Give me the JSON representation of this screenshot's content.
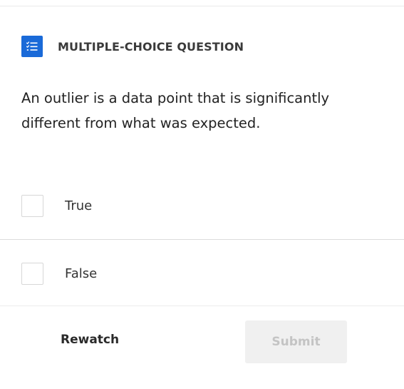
{
  "header": {
    "icon": "checklist-icon",
    "question_type": "MULTIPLE-CHOICE QUESTION"
  },
  "question": {
    "text": "An outlier is a data point that is significantly different from what was expected."
  },
  "options": [
    {
      "label": "True",
      "checked": false
    },
    {
      "label": "False",
      "checked": false
    }
  ],
  "footer": {
    "rewatch_label": "Rewatch",
    "submit_label": "Submit",
    "submit_enabled": false
  },
  "colors": {
    "accent": "#1a6ad8",
    "submit_bg_disabled": "#f0f0f0",
    "submit_text_disabled": "#c4c4c4"
  }
}
